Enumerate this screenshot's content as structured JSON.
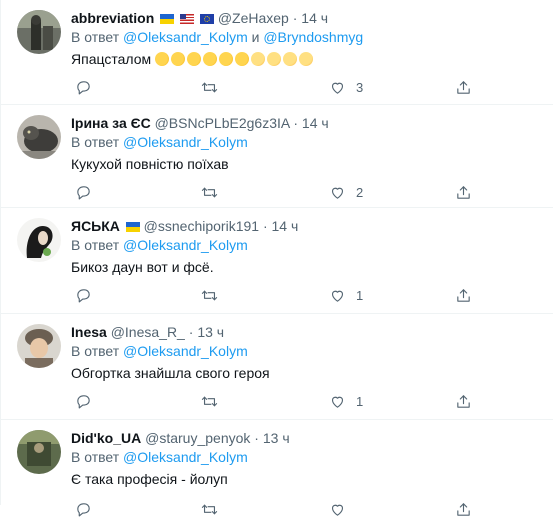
{
  "tweets": [
    {
      "name": "abbreviation",
      "handle": "@ZeHaxep",
      "time": "14 ч",
      "reply_prefix": "В ответ",
      "reply_mentions": [
        "@Oleksandr_Kolym",
        "@Bryndoshmyg"
      ],
      "reply_joiner": "и",
      "text": "Япацсталом",
      "emojis": [
        "rofl",
        "rofl",
        "rofl",
        "rofl",
        "rofl",
        "rofl",
        "sweat",
        "sweat",
        "sweat",
        "sweat"
      ],
      "flags": [
        "ua",
        "us",
        "eu"
      ],
      "likes": "3",
      "retweets": ""
    },
    {
      "name": "Ірина за ЄС",
      "handle": "@BSNcPLbE2g6z3IA",
      "time": "14 ч",
      "reply_prefix": "В ответ",
      "reply_mentions": [
        "@Oleksandr_Kolym"
      ],
      "text": "Кукухой повністю поїхав",
      "likes": "2",
      "retweets": ""
    },
    {
      "name": "ЯСЬКА",
      "handle": "@ssnechiporik191",
      "time": "14 ч",
      "reply_prefix": "В ответ",
      "reply_mentions": [
        "@Oleksandr_Kolym"
      ],
      "text": "Бикоз даун вот и фсё.",
      "flags": [
        "ua"
      ],
      "likes": "1",
      "retweets": ""
    },
    {
      "name": "Inesa",
      "handle": "@Inesa_R_",
      "time": "13 ч",
      "reply_prefix": "В ответ",
      "reply_mentions": [
        "@Oleksandr_Kolym"
      ],
      "text": "Обгортка знайшла свого героя",
      "likes": "1",
      "retweets": ""
    },
    {
      "name": "Did'ko_UA",
      "handle": "@staruy_penyok",
      "time": "13 ч",
      "reply_prefix": "В ответ",
      "reply_mentions": [
        "@Oleksandr_Kolym"
      ],
      "text": "Є така професія - йолуп",
      "likes": "",
      "retweets": ""
    }
  ],
  "separator": "·",
  "icons": {
    "reply": "reply-icon",
    "retweet": "retweet-icon",
    "like": "heart-icon",
    "share": "share-icon"
  },
  "colors": {
    "link": "#1d9bf0",
    "muted": "#536471",
    "text": "#0f1419",
    "divider": "#eff3f4"
  }
}
